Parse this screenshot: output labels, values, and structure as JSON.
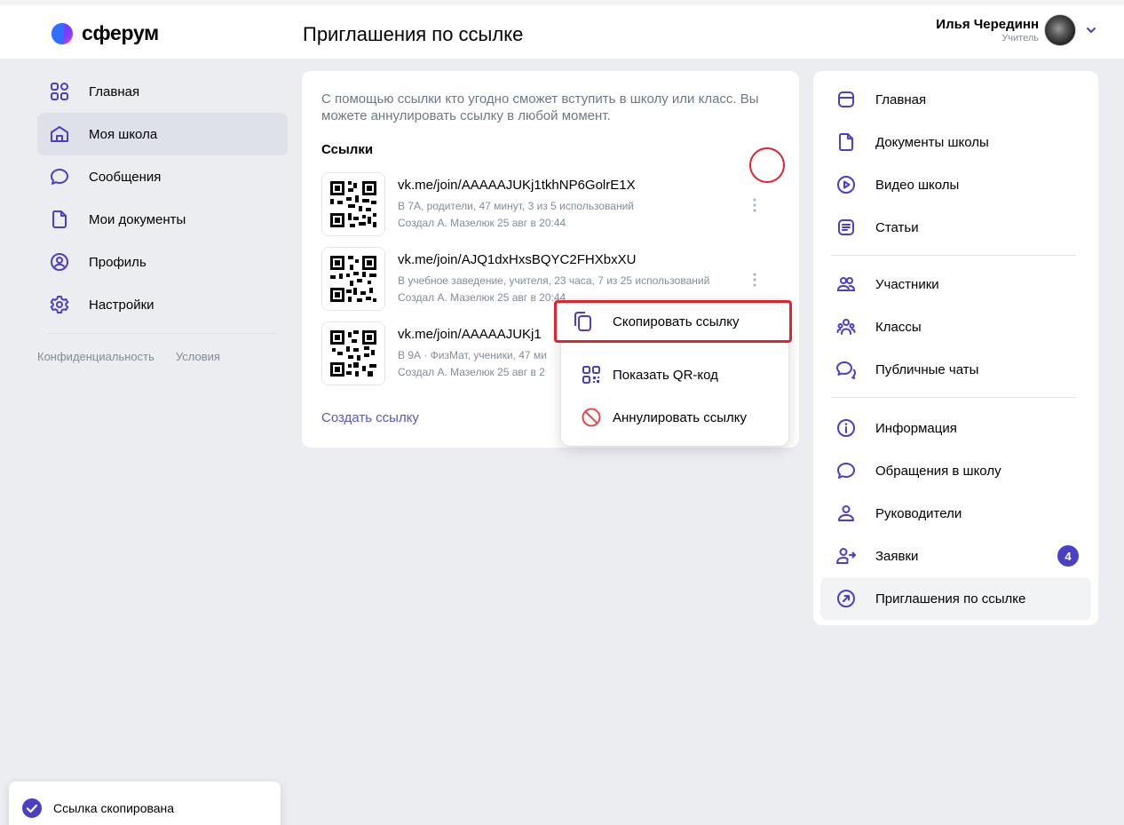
{
  "header": {
    "logo_text": "сферум",
    "page_title": "Приглашения по ссылке",
    "user_name": "Илья Черединн",
    "user_role": "Учитель"
  },
  "left_nav": {
    "items": [
      {
        "label": "Главная",
        "icon": "grid-icon"
      },
      {
        "label": "Моя школа",
        "icon": "school-icon"
      },
      {
        "label": "Сообщения",
        "icon": "message-icon"
      },
      {
        "label": "Мои документы",
        "icon": "document-icon"
      },
      {
        "label": "Профиль",
        "icon": "profile-icon"
      },
      {
        "label": "Настройки",
        "icon": "gear-icon"
      }
    ],
    "footer": {
      "privacy": "Конфиденциальность",
      "terms": "Условия"
    }
  },
  "main": {
    "description": "С помощью ссылки кто угодно сможет вступить в школу или класс. Вы можете аннулировать ссылку в любой момент.",
    "links_title": "Ссылки",
    "links": [
      {
        "url": "vk.me/join/AAAAAJUKj1tkhNP6GolrE1X",
        "meta1": "В 7А, родители, 47 минут, 3 из 5 использований",
        "meta2": "Создал А. Мазелюк 25 авг в 20:44"
      },
      {
        "url": "vk.me/join/AJQ1dxHxsBQYC2FHXbxXU",
        "meta1": "В учебное заведение, учителя, 23 часа, 7 из 25 использований",
        "meta2": "Создал А. Мазелюк 25 авг в 20:44"
      },
      {
        "url": "vk.me/join/AAAAAJUKj1",
        "meta1": "В 9А · ФизМат, ученики, 47 ми",
        "meta2": "Создал А. Мазелюк 25 авг в 2"
      }
    ],
    "create_link": "Создать ссылку"
  },
  "context_menu": {
    "copy": "Скопировать ссылку",
    "show_qr": "Показать QR-код",
    "revoke": "Аннулировать ссылку"
  },
  "right_nav": {
    "items": [
      {
        "label": "Главная",
        "icon": "home-square-icon"
      },
      {
        "label": "Документы школы",
        "icon": "document-icon"
      },
      {
        "label": "Видео школы",
        "icon": "play-icon"
      },
      {
        "label": "Статьи",
        "icon": "article-icon"
      },
      {
        "label": "Участники",
        "icon": "users-icon"
      },
      {
        "label": "Классы",
        "icon": "group-icon"
      },
      {
        "label": "Публичные чаты",
        "icon": "chats-icon"
      },
      {
        "label": "Информация",
        "icon": "info-icon"
      },
      {
        "label": "Обращения в школу",
        "icon": "message-icon"
      },
      {
        "label": "Руководители",
        "icon": "user-icon"
      },
      {
        "label": "Заявки",
        "icon": "user-arrow-icon",
        "badge": "4"
      },
      {
        "label": "Приглашения по ссылке",
        "icon": "link-arrow-icon"
      }
    ]
  },
  "toast": {
    "text": "Ссылка скопирована"
  },
  "colors": {
    "accent": "#4b3fc4",
    "link": "#5a56c7",
    "highlight": "#e0232e"
  }
}
